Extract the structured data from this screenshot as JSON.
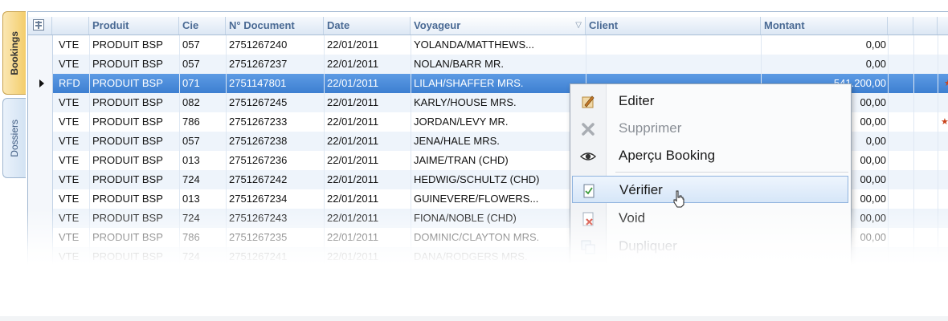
{
  "tabs": [
    {
      "label": "Bookings",
      "active": true
    },
    {
      "label": "Dossiers",
      "active": false
    }
  ],
  "grid": {
    "columns": [
      "Produit",
      "Cie",
      "N° Document",
      "Date",
      "Voyageur",
      "Client",
      "Montant"
    ],
    "rows": [
      {
        "type": "VTE",
        "produit": "PRODUIT BSP",
        "cie": "057",
        "doc": "2751267240",
        "date": "22/01/2011",
        "voyageur": "YOLANDA/MATTHEWS...",
        "montant": "0,00"
      },
      {
        "type": "VTE",
        "produit": "PRODUIT BSP",
        "cie": "057",
        "doc": "2751267237",
        "date": "22/01/2011",
        "voyageur": "NOLAN/BARR MR.",
        "montant": "0,00"
      },
      {
        "type": "RFD",
        "produit": "PRODUIT BSP",
        "cie": "071",
        "doc": "2751147801",
        "date": "22/01/2011",
        "voyageur": "LILAH/SHAFFER MRS.",
        "montant": "-541.200,00"
      },
      {
        "type": "VTE",
        "produit": "PRODUIT BSP",
        "cie": "082",
        "doc": "2751267245",
        "date": "22/01/2011",
        "voyageur": "KARLY/HOUSE MRS.",
        "montant": "00,00"
      },
      {
        "type": "VTE",
        "produit": "PRODUIT BSP",
        "cie": "786",
        "doc": "2751267233",
        "date": "22/01/2011",
        "voyageur": "JORDAN/LEVY MR.",
        "montant": "00,00"
      },
      {
        "type": "VTE",
        "produit": "PRODUIT BSP",
        "cie": "057",
        "doc": "2751267238",
        "date": "22/01/2011",
        "voyageur": "JENA/HALE MRS.",
        "montant": "0,00"
      },
      {
        "type": "VTE",
        "produit": "PRODUIT BSP",
        "cie": "013",
        "doc": "2751267236",
        "date": "22/01/2011",
        "voyageur": "JAIME/TRAN (CHD)",
        "montant": "00,00"
      },
      {
        "type": "VTE",
        "produit": "PRODUIT BSP",
        "cie": "724",
        "doc": "2751267242",
        "date": "22/01/2011",
        "voyageur": "HEDWIG/SCHULTZ (CHD)",
        "montant": "00,00"
      },
      {
        "type": "VTE",
        "produit": "PRODUIT BSP",
        "cie": "013",
        "doc": "2751267234",
        "date": "22/01/2011",
        "voyageur": "GUINEVERE/FLOWERS...",
        "montant": "00,00"
      },
      {
        "type": "VTE",
        "produit": "PRODUIT BSP",
        "cie": "724",
        "doc": "2751267243",
        "date": "22/01/2011",
        "voyageur": "FIONA/NOBLE (CHD)",
        "montant": "00,00"
      },
      {
        "type": "VTE",
        "produit": "PRODUIT BSP",
        "cie": "786",
        "doc": "2751267235",
        "date": "22/01/2011",
        "voyageur": "DOMINIC/CLAYTON MRS.",
        "montant": "00,00"
      },
      {
        "type": "VTE",
        "produit": "PRODUIT BSP",
        "cie": "724",
        "doc": "2751267241",
        "date": "22/01/2011",
        "voyageur": "DANA/RODGERS MRS.",
        "montant": ""
      }
    ]
  },
  "context_menu": {
    "items": [
      {
        "label": "Editer",
        "icon": "edit-icon",
        "enabled": true
      },
      {
        "label": "Supprimer",
        "icon": "delete-icon",
        "enabled": false
      },
      {
        "label": "Aperçu Booking",
        "icon": "eye-icon",
        "enabled": true
      },
      {
        "label": "Vérifier",
        "icon": "check-document-icon",
        "enabled": true,
        "hover": true
      },
      {
        "label": "Void",
        "icon": "void-document-icon",
        "enabled": true
      },
      {
        "label": "Dupliquer",
        "icon": "duplicate-icon",
        "enabled": false
      }
    ]
  },
  "colors": {
    "selection": "#3d7fd1",
    "header_text": "#4a6a94",
    "active_tab": "#f3cd6b"
  }
}
